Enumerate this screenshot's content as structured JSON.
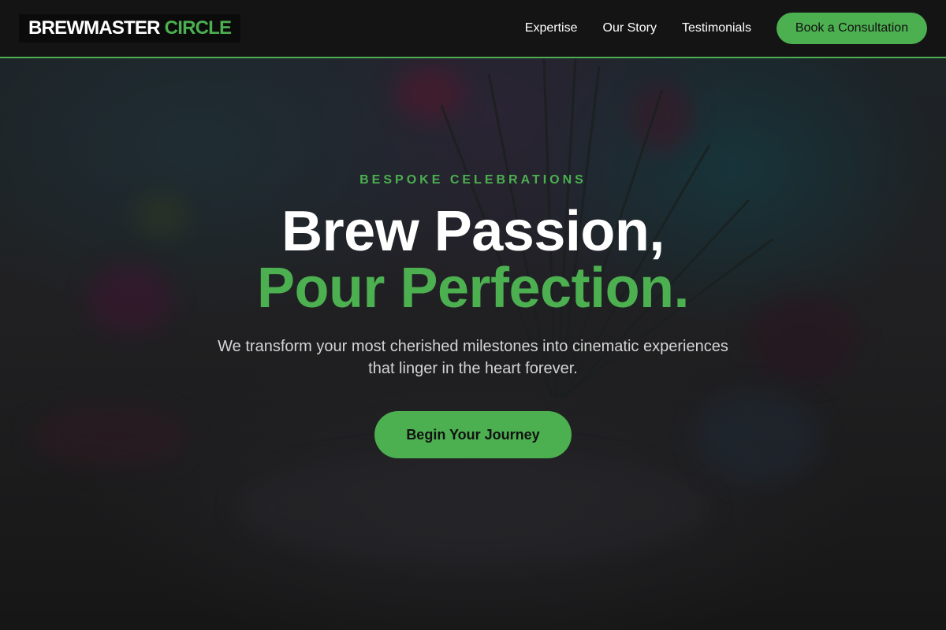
{
  "header": {
    "logo": {
      "word1": "BREWMASTER",
      "word2": "CIRCLE"
    },
    "nav": [
      {
        "label": "Expertise"
      },
      {
        "label": "Our Story"
      },
      {
        "label": "Testimonials"
      }
    ],
    "cta_label": "Book a Consultation"
  },
  "hero": {
    "eyebrow": "BESPOKE CELEBRATIONS",
    "headline_line1": "Brew Passion,",
    "headline_line2": "Pour Perfection.",
    "tagline": "We transform your most cherished milestones into cinematic experiences that linger in the heart forever.",
    "cta_label": "Begin Your Journey"
  },
  "colors": {
    "accent": "#4caf50",
    "header_bg": "#141414",
    "page_bg": "#161616",
    "text": "#ffffff",
    "muted_text": "#d4d4d4"
  },
  "icons": []
}
